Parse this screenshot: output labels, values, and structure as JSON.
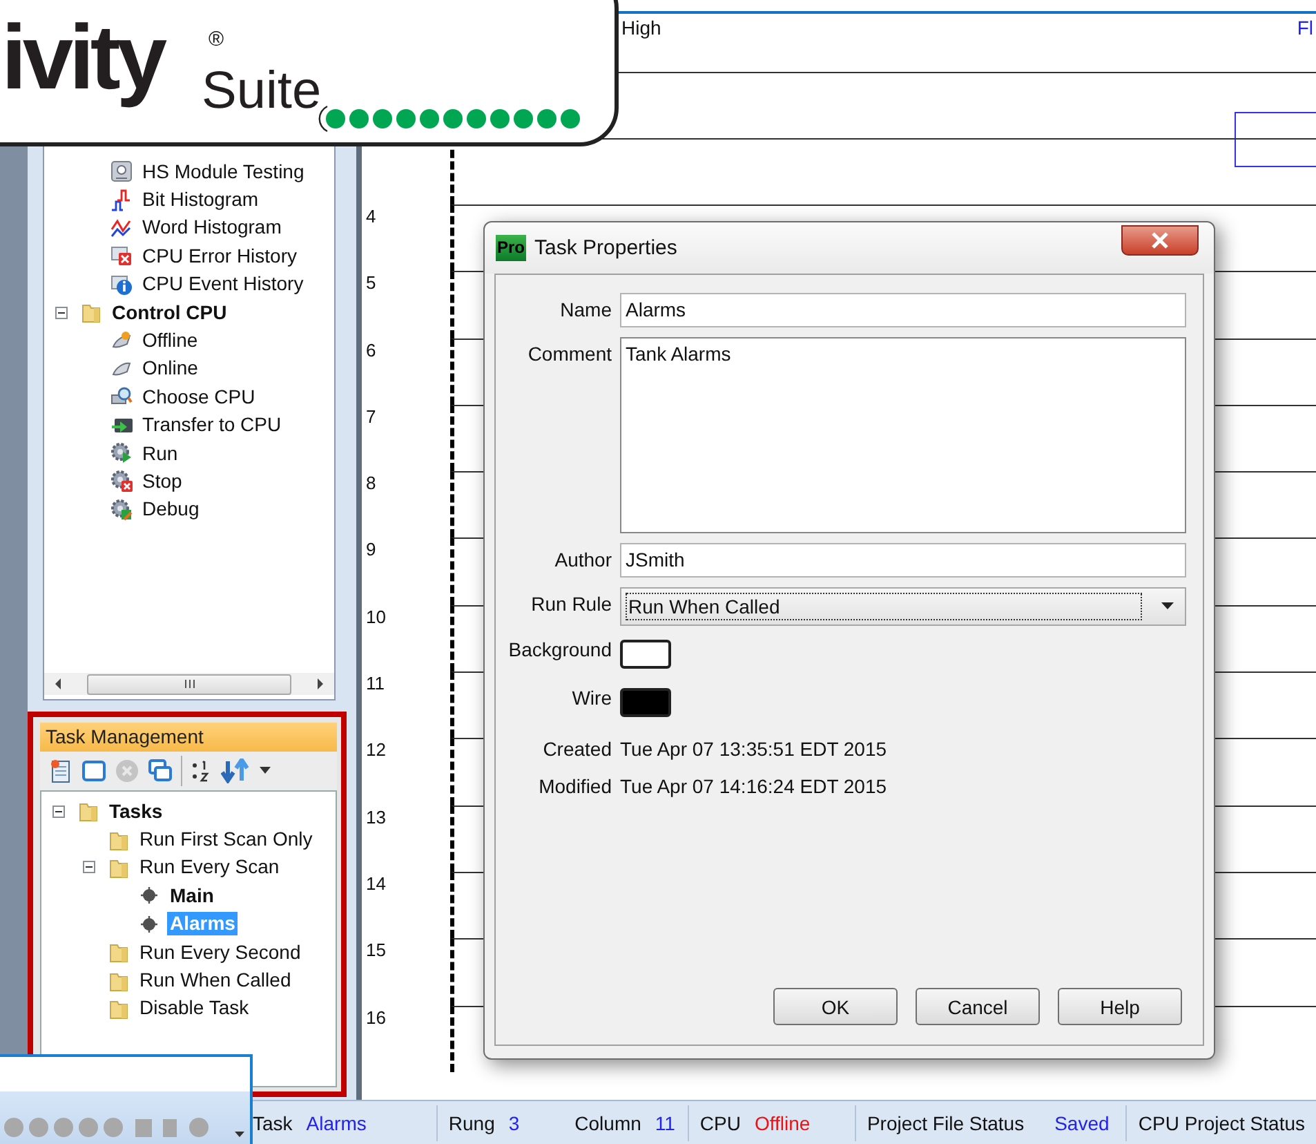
{
  "logo": {
    "text": "ivity",
    "mark": "®",
    "suffix": "Suite"
  },
  "project_tree": {
    "items": [
      {
        "children": [
          {
            "label": "HS Module Testing",
            "kind": "module",
            "selected": false
          },
          {
            "label": "Bit Histogram",
            "kind": "bit-chart",
            "selected": false
          },
          {
            "label": "Word Histogram",
            "kind": "word-chart",
            "selected": false
          },
          {
            "label": "CPU Error History",
            "kind": "error",
            "selected": false
          },
          {
            "label": "CPU Event History",
            "kind": "info",
            "selected": false
          }
        ]
      },
      {
        "label": "Control CPU",
        "kind": "group",
        "expanded": true,
        "selected": false,
        "children": [
          {
            "label": "Offline",
            "kind": "offline",
            "selected": false
          },
          {
            "label": "Online",
            "kind": "online",
            "selected": false
          },
          {
            "label": "Choose CPU",
            "kind": "choose",
            "selected": false
          },
          {
            "label": "Transfer to CPU",
            "kind": "transfer",
            "selected": false
          },
          {
            "label": "Run",
            "kind": "run",
            "selected": false
          },
          {
            "label": "Stop",
            "kind": "stop",
            "selected": false
          },
          {
            "label": "Debug",
            "kind": "debug",
            "selected": false
          }
        ]
      }
    ]
  },
  "task_management": {
    "title": "Task Management",
    "tree": [
      {
        "label": "Tasks",
        "kind": "group",
        "expanded": true,
        "selected": false,
        "children": [
          {
            "label": "Run First Scan Only",
            "kind": "folder",
            "selected": false
          },
          {
            "label": "Run Every Scan",
            "kind": "folder",
            "expanded": true,
            "selected": false,
            "children": [
              {
                "label": "Main",
                "kind": "task",
                "selected": false
              },
              {
                "label": "Alarms",
                "kind": "task",
                "selected": true
              }
            ]
          },
          {
            "label": "Run Every Second",
            "kind": "folder",
            "selected": false
          },
          {
            "label": "Run When Called",
            "kind": "folder",
            "selected": false
          },
          {
            "label": "Disable Task",
            "kind": "folder",
            "selected": false
          }
        ]
      }
    ]
  },
  "ladder": {
    "header_left": "High",
    "header_right": "Fl",
    "rungs": [
      "4",
      "5",
      "6",
      "7",
      "8",
      "9",
      "10",
      "11",
      "12",
      "13",
      "14",
      "15",
      "16"
    ]
  },
  "dialog": {
    "badge": "Pro",
    "title": "Task Properties",
    "fields": [
      {
        "kind": "text",
        "label": "Name",
        "value": "Alarms"
      },
      {
        "kind": "textarea",
        "label": "Comment",
        "value": "Tank Alarms"
      },
      {
        "kind": "text",
        "label": "Author",
        "value": "JSmith"
      },
      {
        "kind": "select",
        "label": "Run Rule",
        "value": "Run When Called"
      },
      {
        "kind": "color",
        "label": "Background",
        "color": "#ffffff"
      },
      {
        "kind": "color",
        "label": "Wire",
        "color": "#000000"
      },
      {
        "kind": "info",
        "label": "Created",
        "value": "Tue Apr 07 13:35:51 EDT 2015"
      },
      {
        "kind": "info",
        "label": "Modified",
        "value": "Tue Apr 07 14:16:24 EDT 2015"
      }
    ],
    "buttons": [
      "OK",
      "Cancel",
      "Help"
    ]
  },
  "status_bar": [
    {
      "items": [
        {
          "label": "Task",
          "value": "Alarms",
          "color": "#2222ee"
        }
      ]
    },
    {
      "items": [
        {
          "label": "Rung",
          "value": "3",
          "color": "#2222ee"
        },
        {
          "label": "Column",
          "value": "11",
          "color": "#2222ee"
        }
      ]
    },
    {
      "items": [
        {
          "label": "CPU",
          "value": "Offline",
          "color": "#ee1111"
        }
      ]
    },
    {
      "items": [
        {
          "label": "Project File Status",
          "value": "Saved",
          "color": "#2222ee"
        }
      ]
    },
    {
      "items": [
        {
          "label": "CPU Project Status"
        }
      ]
    }
  ]
}
